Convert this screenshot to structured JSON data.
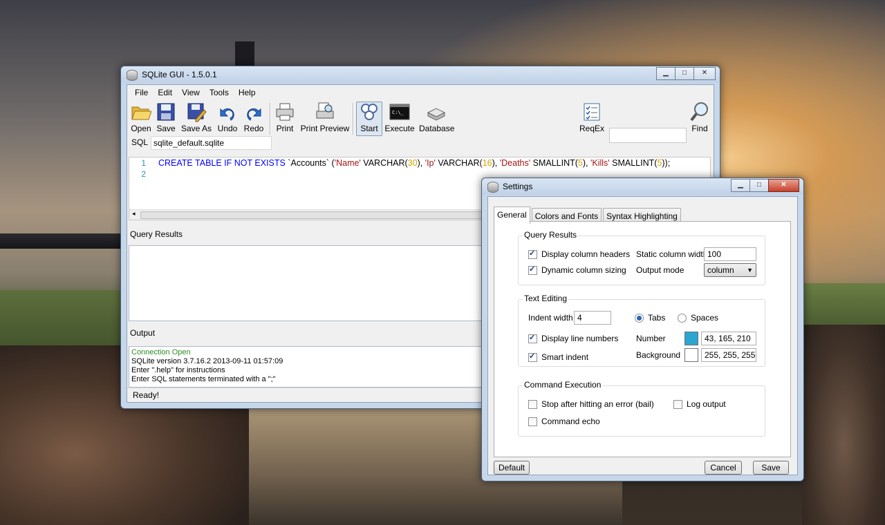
{
  "main": {
    "title": "SQLite GUI - 1.5.0.1",
    "menu": [
      "File",
      "Edit",
      "View",
      "Tools",
      "Help"
    ],
    "toolbar": {
      "open": "Open",
      "save": "Save",
      "save_as": "Save As",
      "undo": "Undo",
      "redo": "Redo",
      "print": "Print",
      "print_preview": "Print Preview",
      "start": "Start",
      "execute": "Execute",
      "database": "Database",
      "reqex": "ReqEx",
      "find": "Find"
    },
    "sql_label": "SQL",
    "sql_file": "sqlite_default.sqlite",
    "editor": {
      "line_numbers": [
        "1",
        "2"
      ],
      "code": {
        "kw": "CREATE TABLE IF NOT EXISTS",
        "tbl": " `Accounts` (",
        "c1": "'Name'",
        "t1": " VARCHAR(",
        "n1": "30",
        "t1b": "), ",
        "c2": "'Ip'",
        "t2": " VARCHAR(",
        "n2": "16",
        "t2b": "), ",
        "c3": "'Deaths'",
        "t3": " SMALLINT(",
        "n3": "5",
        "t3b": "), ",
        "c4": "'Kills'",
        "t4": " SMALLINT(",
        "n4": "5",
        "t4b": "));"
      }
    },
    "query_results_label": "Query Results",
    "output_label": "Output",
    "output_lines": [
      "Connection Open",
      "SQLite version 3.7.16.2 2013-09-11 01:57:09",
      "Enter \".help\" for instructions",
      "Enter SQL statements terminated with a \";\""
    ],
    "status": "Ready!"
  },
  "settings": {
    "title": "Settings",
    "tabs": [
      "General",
      "Colors and Fonts",
      "Syntax Highlighting"
    ],
    "query_results": {
      "title": "Query Results",
      "display_headers": "Display column headers",
      "dynamic_sizing": "Dynamic column sizing",
      "static_width_label": "Static column width",
      "static_width_value": "100",
      "output_mode_label": "Output mode",
      "output_mode_value": "column"
    },
    "text_editing": {
      "title": "Text Editing",
      "indent_width_label": "Indent width",
      "indent_width_value": "4",
      "tabs_label": "Tabs",
      "spaces_label": "Spaces",
      "line_numbers": "Display line numbers",
      "smart_indent": "Smart indent",
      "number_label": "Number",
      "number_color": "43, 165, 210",
      "number_swatch": "#2ba5d2",
      "background_label": "Background",
      "background_color": "255, 255, 255",
      "background_swatch": "#ffffff"
    },
    "command_execution": {
      "title": "Command Execution",
      "bail": "Stop after hitting an error (bail)",
      "log_output": "Log output",
      "echo": "Command echo"
    },
    "buttons": {
      "default": "Default",
      "cancel": "Cancel",
      "save": "Save"
    }
  }
}
